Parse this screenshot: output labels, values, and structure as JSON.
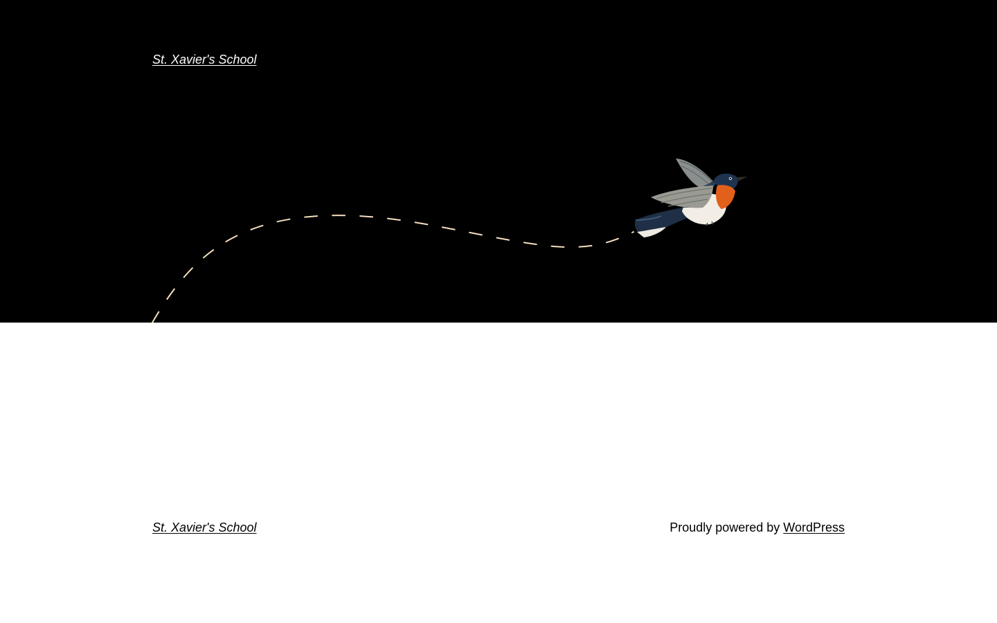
{
  "header": {
    "site_title": "St. Xavier's School"
  },
  "hero": {
    "illustration": "bird-icon",
    "flight_path_color": "#f5dfc0",
    "background_color": "#000000"
  },
  "footer": {
    "site_title": "St. Xavier's School",
    "credit_prefix": "Proudly powered by",
    "credit_link": "WordPress"
  }
}
